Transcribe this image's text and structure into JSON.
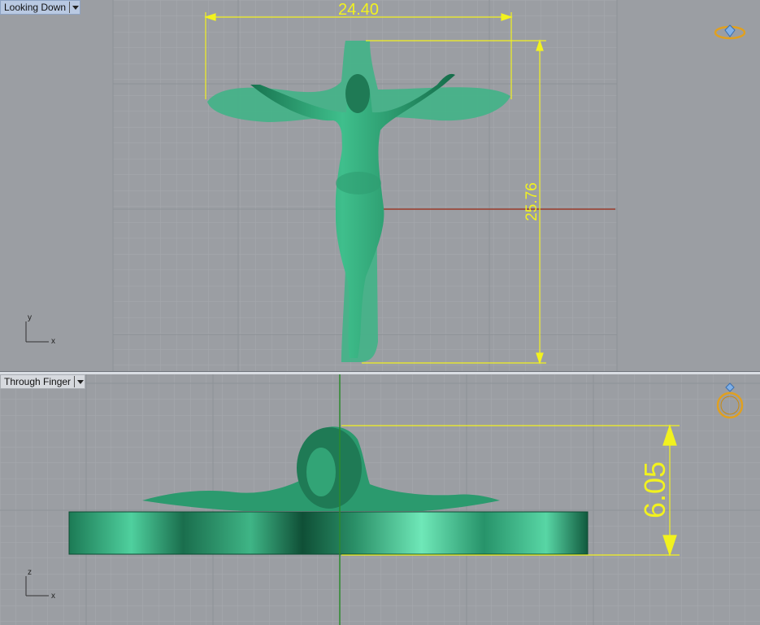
{
  "viewports": {
    "top": {
      "label": "Looking Down",
      "width_dim": "24.40",
      "height_dim": "25.76",
      "axis_x": "x",
      "axis_y": "y"
    },
    "bottom": {
      "label": "Through Finger",
      "height_dim": "6.05",
      "axis_x": "x",
      "axis_y": "z"
    }
  },
  "colors": {
    "model": "#2e9a70",
    "dimension": "#f2f21e",
    "grid_minor": "#a6a9ae",
    "grid_major": "#8c9095"
  },
  "icons": {
    "top_corner": "ring-top-view-icon",
    "bottom_corner": "ring-side-view-icon"
  }
}
